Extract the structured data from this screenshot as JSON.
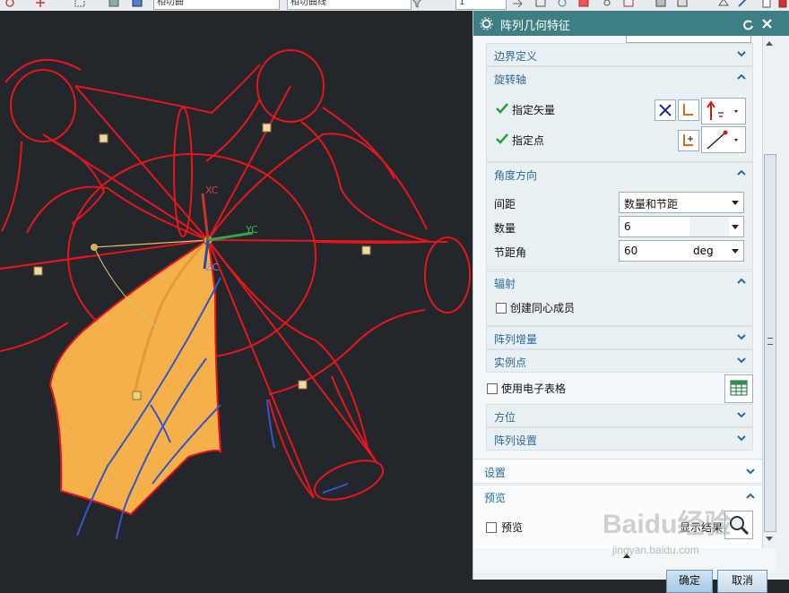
{
  "toolbar": {
    "dropdown1": "相切曲",
    "dropdown2": "相切曲线",
    "dropdown3": "1"
  },
  "viewport": {
    "axis_labels": {
      "xc": "XC",
      "yc": "YC",
      "zc": "ZC"
    },
    "colors": {
      "curve": "#e8151b",
      "face": "#f5b04a",
      "edge_blue": "#3556c9"
    }
  },
  "dialog": {
    "title": "阵列几何特征",
    "sections": {
      "boundary": "边界定义",
      "rotation_axis": "旋转轴",
      "angle_direction": "角度方向",
      "radiate": "辐射",
      "array_increment": "阵列增量",
      "instance_points": "实例点",
      "orientation": "方位",
      "array_settings": "阵列设置",
      "settings": "设置",
      "preview": "预览"
    },
    "rotation_axis": {
      "specify_vector": "指定矢量",
      "specify_point": "指定点"
    },
    "angle_direction": {
      "spacing_label": "间距",
      "spacing_value": "数量和节距",
      "count_label": "数量",
      "count_value": "6",
      "pitch_label": "节距角",
      "pitch_value": "60",
      "pitch_unit": "deg"
    },
    "radiate": {
      "concentric_label": "创建同心成员"
    },
    "spreadsheet_label": "使用电子表格",
    "preview": {
      "preview_label": "预览",
      "show_result": "显示结果"
    },
    "buttons": {
      "ok": "确定",
      "cancel": "取消"
    }
  },
  "watermark": {
    "brand": "Baidu经验",
    "url": "jingyan.baidu.com"
  }
}
